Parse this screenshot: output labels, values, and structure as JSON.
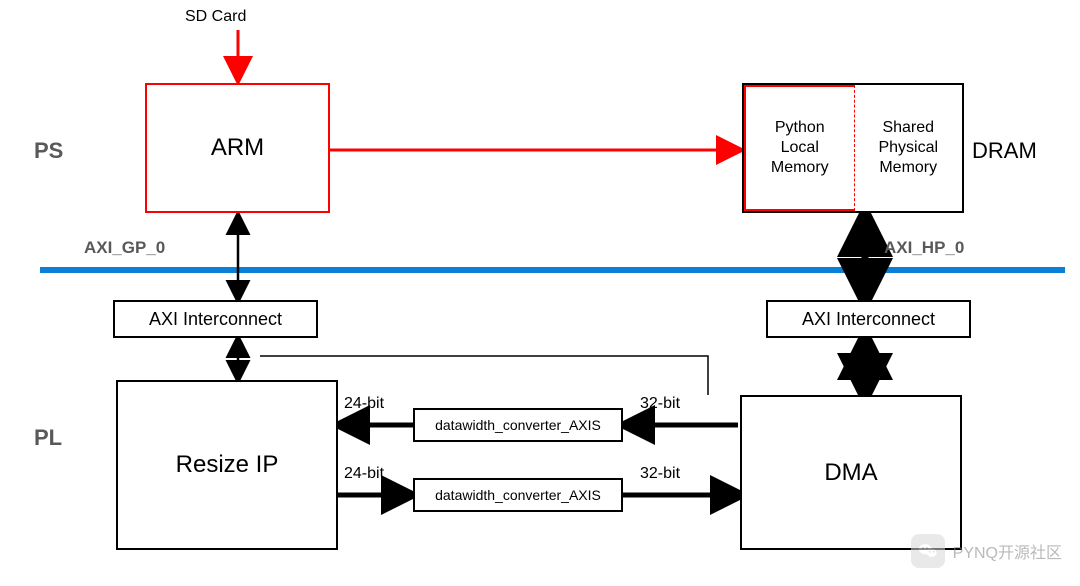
{
  "side_labels": {
    "ps": "PS",
    "pl": "PL",
    "dram": "DRAM"
  },
  "top_label": "SD Card",
  "axi_labels": {
    "gp": "AXI_GP_0",
    "hp": "AXI_HP_0"
  },
  "blocks": {
    "arm": "ARM",
    "python_mem": "Python\nLocal\nMemory",
    "shared_mem": "Shared\nPhysical\nMemory",
    "axi_left": "AXI Interconnect",
    "axi_right": "AXI Interconnect",
    "resize": "Resize IP",
    "dma": "DMA",
    "conv1": "datawidth_converter_AXIS",
    "conv2": "datawidth_converter_AXIS"
  },
  "bus_labels": {
    "l24_top": "24-bit",
    "l32_top": "32-bit",
    "l24_bot": "24-bit",
    "l32_bot": "32-bit"
  },
  "watermark": "PYNQ开源社区"
}
